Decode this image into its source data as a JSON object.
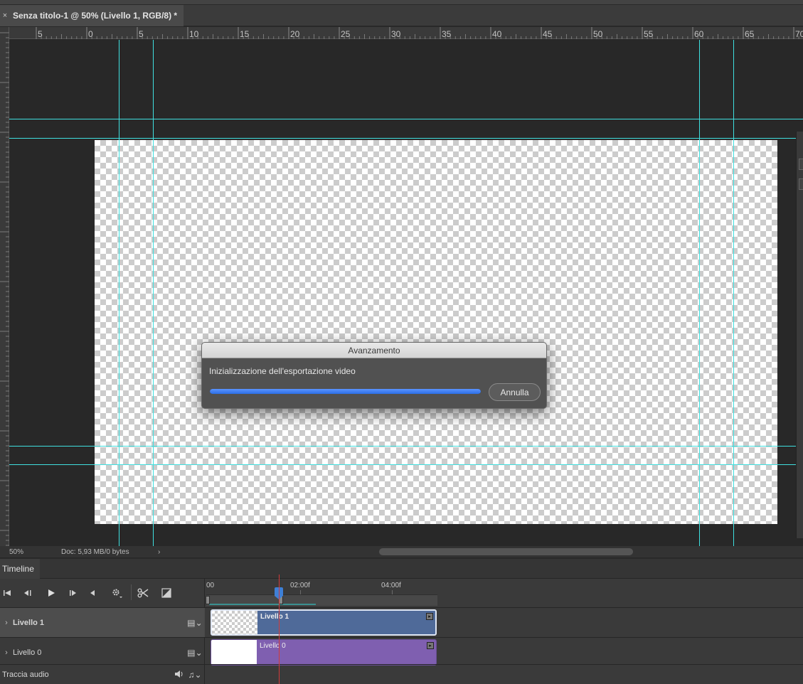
{
  "document": {
    "tab_title": "Senza titolo-1 @ 50% (Livello 1, RGB/8) *",
    "close_glyph": "×"
  },
  "rulers": {
    "top_labels": [
      "5",
      "0",
      "5",
      "10",
      "15",
      "20",
      "25",
      "30",
      "35",
      "40",
      "45",
      "50",
      "55",
      "60",
      "65",
      "70"
    ]
  },
  "status": {
    "zoom": "50%",
    "doc_info": "Doc: 5,93 MB/0 bytes",
    "arrow": "›"
  },
  "timeline": {
    "panel_title": "Timeline",
    "time_labels": [
      "00",
      "02:00f",
      "04:00f"
    ],
    "tracks": [
      {
        "name": "Livello 1",
        "clip_label": "Livello 1",
        "clip_color": "#4f6a99",
        "thumb": "transparent"
      },
      {
        "name": "Livello 0",
        "clip_label": "Livello 0",
        "clip_color": "#7f5fb0",
        "thumb": "white"
      }
    ],
    "audio_track": "Traccia audio",
    "controls": [
      "go-to-first-frame-icon",
      "previous-frame-icon",
      "play-icon",
      "next-frame-icon",
      "mute-audio-icon",
      "settings-gear-icon",
      "split-scissors-icon",
      "transition-icon"
    ]
  },
  "dialog": {
    "title": "Avanzamento",
    "message": "Inizializzazione dell'esportazione video",
    "cancel_label": "Annulla",
    "progress": 1.0
  },
  "colors": {
    "guide": "#3fe0e0",
    "playhead": "#d23a3a",
    "progress": "#3f7fe8"
  }
}
